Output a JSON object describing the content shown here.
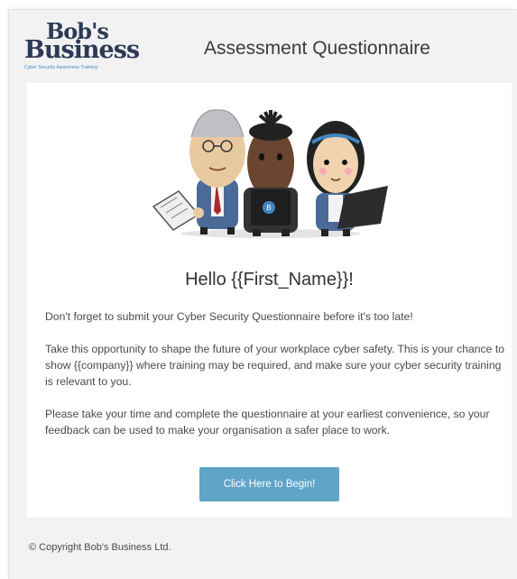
{
  "header": {
    "logo_line1": "Bob's",
    "logo_line2": "Business",
    "logo_tagline": "Cyber Security Awareness Training",
    "title": "Assessment Questionnaire"
  },
  "email": {
    "greeting": "Hello {{First_Name}}!",
    "paragraph1": "Don't forget to submit your Cyber Security Questionnaire before it's too late!",
    "paragraph2": "Take this opportunity to shape the future of your workplace cyber safety. This is your chance to show {{company}} where training may be required, and make sure your cyber security training is relevant to you.",
    "paragraph3": "Please take your time and complete the questionnaire at your earliest convenience, so your feedback can be used to make your organisation a safer place to work.",
    "cta_label": "Click Here to Begin!"
  },
  "footer": {
    "copyright": "© Copyright Bob's Business Ltd."
  },
  "colors": {
    "brand_navy": "#2d3a55",
    "brand_blue": "#3f86c1",
    "button": "#5ea5c7",
    "background": "#f2f2f3"
  },
  "icons": [
    "bobs-business-logo",
    "three-characters-illustration"
  ]
}
